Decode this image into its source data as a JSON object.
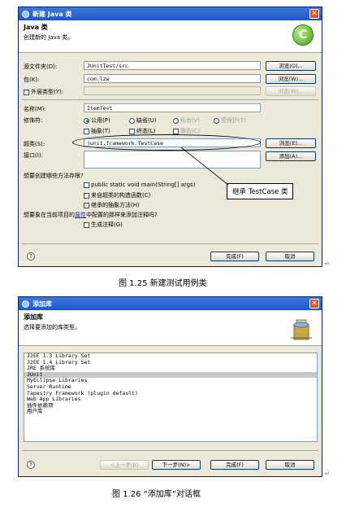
{
  "dialog1": {
    "title": "新建 Java 类",
    "banner_title": "Java 类",
    "banner_sub": "创建新的 Java 类。",
    "logo_letter": "C",
    "source_folder_label": "源文件夹(D):",
    "source_folder_value": "JUnitTest/src",
    "browse1": "浏览(O)...",
    "package_label": "包(K):",
    "package_value": "com.lzw",
    "browse2": "浏览(W)...",
    "enclosing_label": "外层类型(Y):",
    "browse3": "浏览(W)...",
    "name_label": "名称(M):",
    "name_value": "ItemTest",
    "modifiers_label": "修饰符:",
    "mod_public": "公用(P)",
    "mod_default": "缺省(U)",
    "mod_private": "私有(V)",
    "mod_protected": "受保护(T)",
    "mod_abstract": "抽象(T)",
    "mod_final": "终态(L)",
    "mod_static": "静态(C)",
    "superclass_label": "超类(S):",
    "superclass_value": "junit.framework.TestCase",
    "browse4": "浏览(E)...",
    "interfaces_label": "接口(I):",
    "add_button": "添加(A)...",
    "stubs_question": "想要创建哪些方法存根?",
    "stub_main": "public static void main(String[] args)",
    "stub_ctor": "来自超类的构造函数(C)",
    "stub_inherited": "继承的抽象方法(H)",
    "comments_question_a": "想要象在当前项目的",
    "comments_question_link": "属性",
    "comments_question_b": "中配置的那样来添加注释吗?",
    "gen_comments": "生成注释(G)",
    "finish": "完成(F)",
    "cancel": "取消",
    "callout": "继承 TestCase 类"
  },
  "caption1": "图 1.25   新建测试用例类",
  "dialog2": {
    "title": "添加库",
    "banner_title": "添加库",
    "banner_sub": "选择要添加的库类型。",
    "libraries": [
      "J2EE 1.3 Library Set",
      "J2EE 1.4 Library Set",
      "JRE 系统库",
      "JUnit",
      "MyEclipse Libraries",
      "Server Runtime",
      "Tapestry Framework (plugin default)",
      "Web App Libraries",
      "插件依赖项",
      "用户库"
    ],
    "selected_index": 3,
    "back": "<上一步(B)",
    "next": "下一步(N)>",
    "finish": "完成(F)",
    "cancel": "取消"
  },
  "caption2": "图 1.26   “添加库”对话框"
}
